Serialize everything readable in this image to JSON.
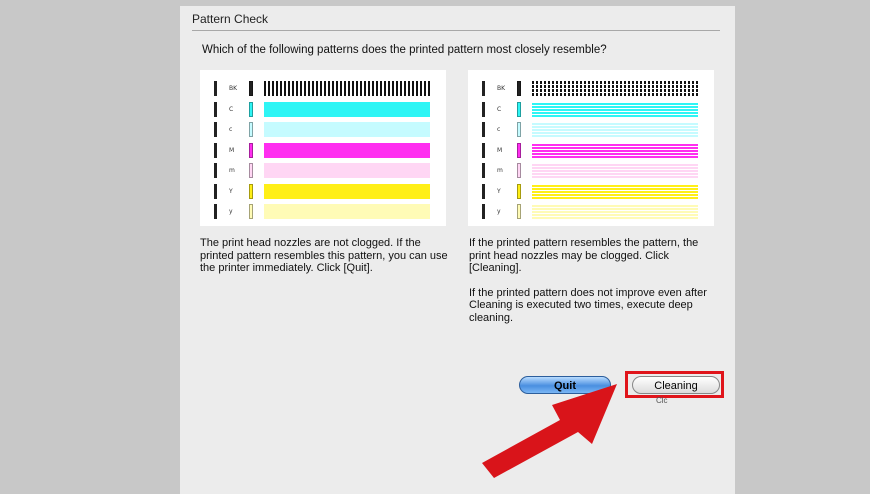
{
  "dialog": {
    "title": "Pattern Check",
    "question": "Which of the following patterns does the printed pattern most closely resemble?",
    "left_pattern": {
      "rows": [
        {
          "label": "BK",
          "color": "#222222"
        },
        {
          "label": "C",
          "color": "#2ef5f5"
        },
        {
          "label": "c",
          "color": "#c5fbff"
        },
        {
          "label": "M",
          "color": "#ff2ef0"
        },
        {
          "label": "m",
          "color": "#ffd6f4"
        },
        {
          "label": "Y",
          "color": "#ffef17"
        },
        {
          "label": "y",
          "color": "#fffbb6"
        }
      ]
    },
    "left_caption": "The print head nozzles are not clogged. If the printed pattern resembles this pattern, you can use the printer immediately. Click [Quit].",
    "right_caption_1": "If the printed pattern resembles the pattern, the print head nozzles may be clogged. Click [Cleaning].",
    "right_caption_2": "If the printed pattern does not improve even after Cleaning is executed two times, execute deep cleaning.",
    "quit_label": "Quit",
    "cleaning_label": "Cleaning",
    "cursor_text": "Clc"
  },
  "colors": {
    "highlight": "#e0151b",
    "arrow": "#d9141a"
  }
}
